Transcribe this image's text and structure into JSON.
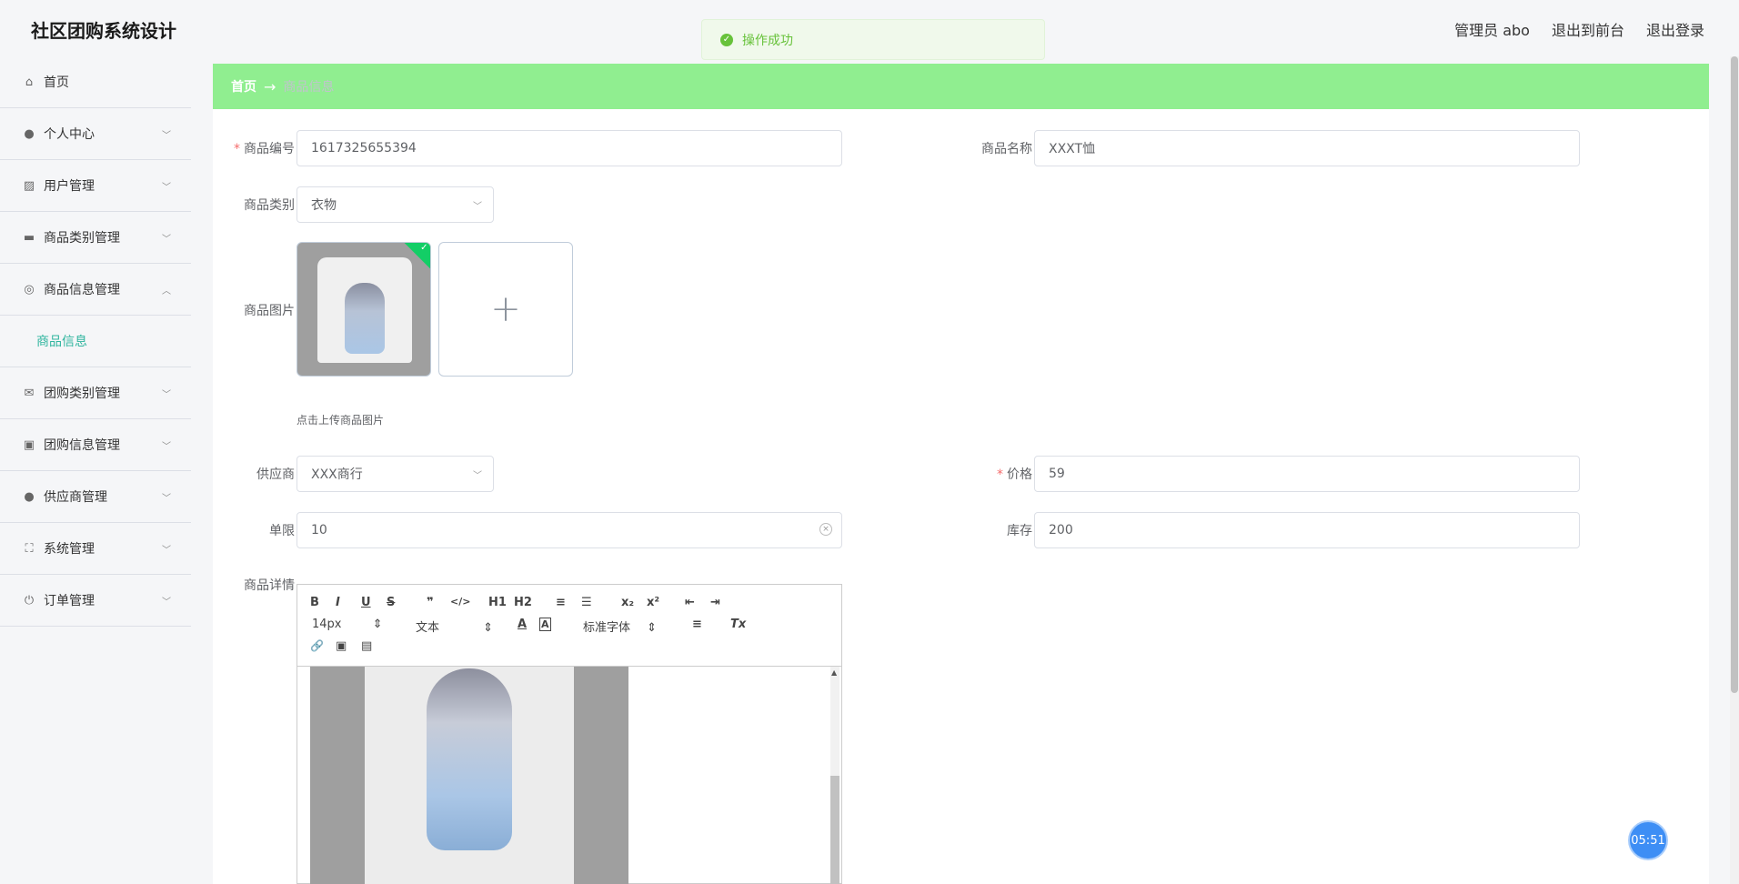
{
  "header": {
    "app_title": "社区团购系统设计",
    "user_label": "管理员 abo",
    "back_label": "退出到前台",
    "logout_label": "退出登录"
  },
  "toast": {
    "message": "操作成功"
  },
  "sidebar": {
    "items": [
      {
        "label": "首页",
        "icon": "home-icon"
      },
      {
        "label": "个人中心",
        "icon": "user-icon"
      },
      {
        "label": "用户管理",
        "icon": "chart-icon"
      },
      {
        "label": "商品类别管理",
        "icon": "briefcase-icon"
      },
      {
        "label": "商品信息管理",
        "icon": "lifebuoy-icon",
        "expanded": true,
        "children": [
          {
            "label": "商品信息"
          }
        ]
      },
      {
        "label": "团购类别管理",
        "icon": "mail-icon"
      },
      {
        "label": "团购信息管理",
        "icon": "clipboard-icon"
      },
      {
        "label": "供应商管理",
        "icon": "user-icon"
      },
      {
        "label": "系统管理",
        "icon": "fullscreen-icon"
      },
      {
        "label": "订单管理",
        "icon": "power-icon"
      }
    ]
  },
  "breadcrumb": {
    "home": "首页",
    "arrow": "→",
    "current": "商品信息"
  },
  "form": {
    "code": {
      "label": "商品编号",
      "value": "1617325655394",
      "required": true
    },
    "name": {
      "label": "商品名称",
      "value": "XXXT恤"
    },
    "category": {
      "label": "商品类别",
      "value": "衣物"
    },
    "image": {
      "label": "商品图片",
      "tip": "点击上传商品图片",
      "add": "+"
    },
    "supplier": {
      "label": "供应商",
      "value": "XXX商行"
    },
    "price": {
      "label": "价格",
      "value": "59",
      "required": true
    },
    "limit": {
      "label": "单限",
      "value": "10"
    },
    "stock": {
      "label": "库存",
      "value": "200"
    },
    "detail": {
      "label": "商品详情"
    }
  },
  "editor": {
    "font_size": "14px",
    "text_type": "文本",
    "font_family": "标准字体",
    "buttons": [
      "B",
      "I",
      "U",
      "S",
      "❞",
      "</>",
      "H1",
      "H2",
      "≡",
      "☰",
      "x₂",
      "x²",
      "⇤",
      "⇥",
      "A",
      "A",
      "≡",
      "Tx",
      "🔗",
      "▣",
      "▤"
    ]
  },
  "timer": {
    "value": "05:51"
  },
  "colors": {
    "accent": "#2fb59e",
    "breadcrumb_bg": "#90ee90",
    "success": "#67c23a",
    "timer": "#3d8ef5"
  }
}
